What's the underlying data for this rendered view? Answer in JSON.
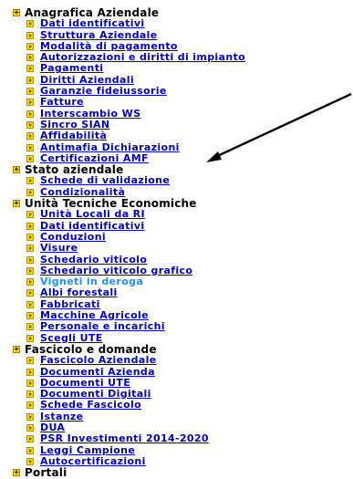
{
  "tree": {
    "sections": [
      {
        "label": "Anagrafica Aziendale",
        "items": [
          {
            "label": "Dati identificativi"
          },
          {
            "label": "Struttura Aziendale"
          },
          {
            "label": "Modalità di pagamento"
          },
          {
            "label": "Autorizzazioni e diritti di impianto"
          },
          {
            "label": "Pagamenti"
          },
          {
            "label": "Diritti Aziendali"
          },
          {
            "label": "Garanzie fideiussorie"
          },
          {
            "label": "Fatture"
          },
          {
            "label": "Interscambio WS"
          },
          {
            "label": "Sincro SIAN"
          },
          {
            "label": "Affidabilità"
          },
          {
            "label": "Antimafia Dichiarazioni"
          },
          {
            "label": "Certificazioni AMF"
          }
        ]
      },
      {
        "label": "Stato aziendale",
        "items": [
          {
            "label": "Schede di validazione"
          },
          {
            "label": "Condizionalità"
          }
        ]
      },
      {
        "label": "Unità Tecniche Economiche",
        "items": [
          {
            "label": "Unità Locali da RI"
          },
          {
            "label": "Dati identificativi"
          },
          {
            "label": "Conduzioni"
          },
          {
            "label": "Visure"
          },
          {
            "label": "Schedario viticolo"
          },
          {
            "label": "Schedario viticolo grafico"
          },
          {
            "label": "Vigneti in deroga",
            "active": true
          },
          {
            "label": "Albi forestali"
          },
          {
            "label": "Fabbricati"
          },
          {
            "label": "Macchine Agricole"
          },
          {
            "label": "Personale e incarichi"
          },
          {
            "label": "Scegli UTE"
          }
        ]
      },
      {
        "label": "Fascicolo e domande",
        "items": [
          {
            "label": "Fascicolo Aziendale"
          },
          {
            "label": "Documenti Azienda"
          },
          {
            "label": "Documenti UTE"
          },
          {
            "label": "Documenti Digitali"
          },
          {
            "label": "Schede Fascicolo"
          },
          {
            "label": "Istanze"
          },
          {
            "label": "DUA"
          },
          {
            "label": "PSR Investimenti 2014-2020"
          },
          {
            "label": "Leggi Campione"
          },
          {
            "label": "Autocertificazioni"
          }
        ]
      },
      {
        "label": "Portali",
        "items": []
      }
    ]
  },
  "colors": {
    "link": "#0000cc",
    "active_link": "#1e90ff",
    "section_text": "#000000",
    "bullet": "#ffd400",
    "arrow": "#000000"
  },
  "icons": {
    "expand": "plus-icon",
    "bullet": "arrow-bullet-icon",
    "annotation": "arrow-annotation"
  }
}
